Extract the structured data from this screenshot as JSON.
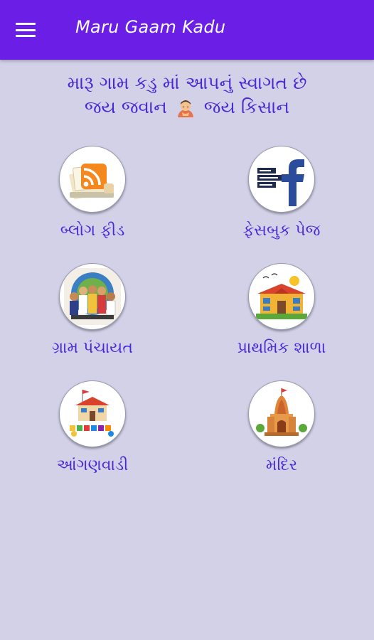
{
  "app_bar": {
    "title": "Maru Gaam Kadu",
    "menu_icon": "hamburger-menu-icon",
    "background": "#6a1ee6"
  },
  "welcome": {
    "line1": "મારૂ ગામ કડુ માં આપનું સ્વાગત છે",
    "line2_left": "જય જવાન",
    "line2_right": "જય કિસાન",
    "emoji_icon": "farmer-bowing-icon"
  },
  "grid": {
    "items": [
      {
        "label": "બ્લોગ ફીડ",
        "icon": "rss-feed-icon"
      },
      {
        "label": "ફેસબુક પેજ",
        "icon": "facebook-icon"
      },
      {
        "label": "ગ્રામ પંચાયત",
        "icon": "gram-panchayat-icon"
      },
      {
        "label": "પ્રાથમિક શાળા",
        "icon": "school-building-icon"
      },
      {
        "label": "આંગણવાડી",
        "icon": "anganwadi-icon"
      },
      {
        "label": "મંદિર",
        "icon": "temple-icon"
      }
    ]
  },
  "colors": {
    "accent": "#6a1ee6",
    "text": "#4a28d4",
    "background": "#d2d1e8"
  }
}
